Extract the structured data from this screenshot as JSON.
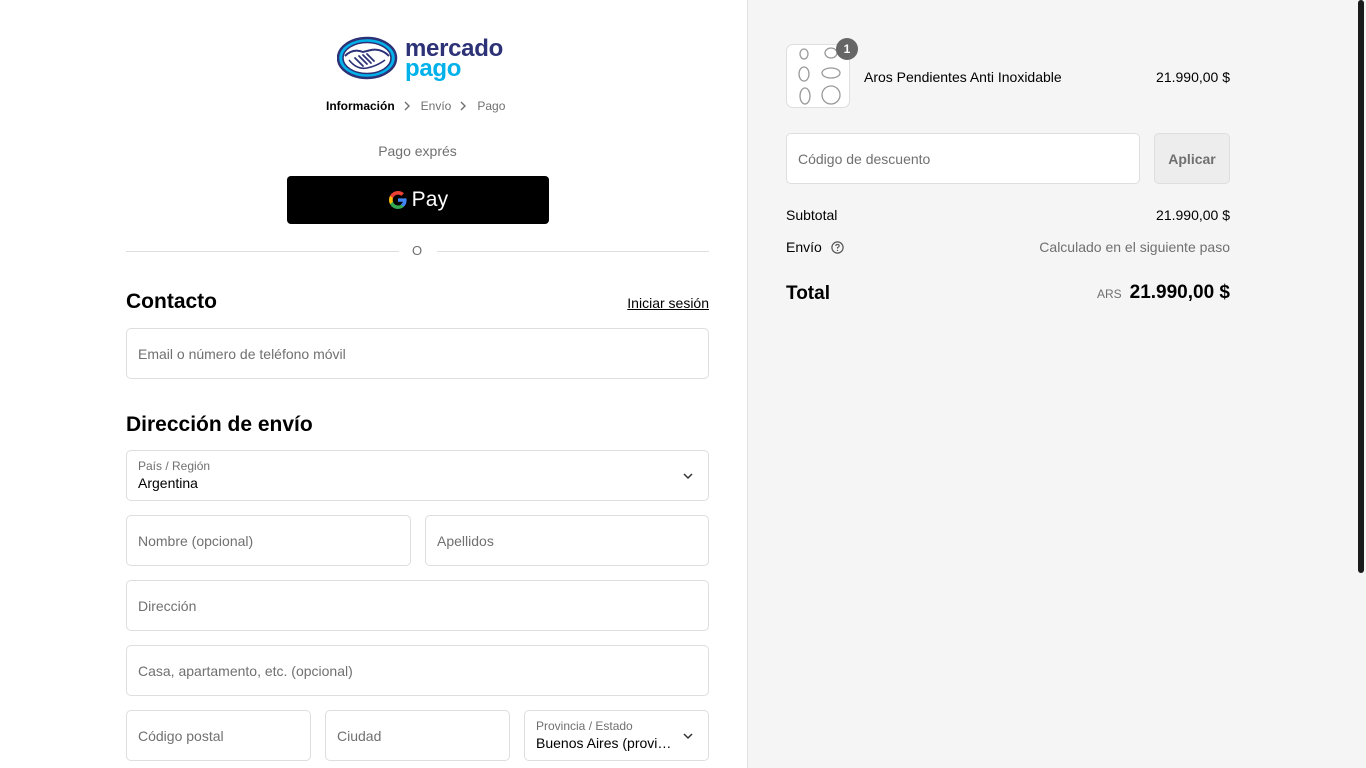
{
  "brand": {
    "logo_line1": "mercado",
    "logo_line2": "pago"
  },
  "breadcrumb": {
    "items": [
      "Información",
      "Envío",
      "Pago"
    ]
  },
  "express": {
    "label": "Pago exprés",
    "gpay_label": "Pay"
  },
  "divider": {
    "or": "O"
  },
  "contact": {
    "title": "Contacto",
    "login": "Iniciar sesión",
    "email_placeholder": "Email o número de teléfono móvil"
  },
  "shipping": {
    "title": "Dirección de envío",
    "country_label": "País / Región",
    "country_value": "Argentina",
    "first_name_placeholder": "Nombre (opcional)",
    "last_name_placeholder": "Apellidos",
    "address_placeholder": "Dirección",
    "apartment_placeholder": "Casa, apartamento, etc. (opcional)",
    "postal_placeholder": "Código postal",
    "city_placeholder": "Ciudad",
    "province_label": "Provincia / Estado",
    "province_value": "Buenos Aires (provincia)"
  },
  "order": {
    "quantity": "1",
    "product_name": "Aros Pendientes Anti Inoxidable",
    "product_price": "21.990,00 $",
    "discount_placeholder": "Código de descuento",
    "apply_label": "Aplicar",
    "subtotal_label": "Subtotal",
    "subtotal_value": "21.990,00 $",
    "shipping_label": "Envío",
    "shipping_value": "Calculado en el siguiente paso",
    "total_label": "Total",
    "total_currency": "ARS",
    "total_value": "21.990,00 $"
  },
  "colors": {
    "brand_navy": "#2d3277",
    "brand_cyan": "#00b1ea",
    "button_black": "#000000",
    "sidebar_bg": "#f5f5f5"
  }
}
